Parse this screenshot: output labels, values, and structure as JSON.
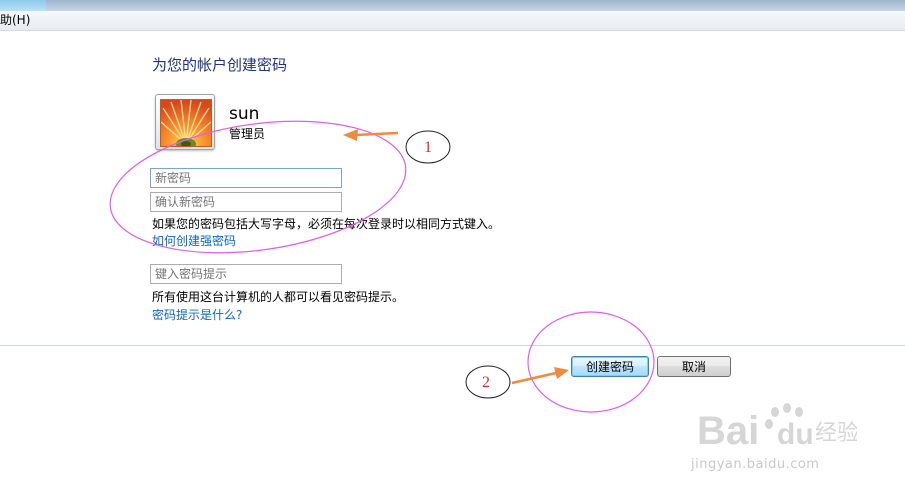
{
  "menu": {
    "help_label": "助(H)"
  },
  "page": {
    "title": "为您的帐户创建密码"
  },
  "user": {
    "name": "sun",
    "role": "管理员"
  },
  "form": {
    "new_password_placeholder": "新密码",
    "confirm_password_placeholder": "确认新密码",
    "case_note": "如果您的密码包括大写字母，必须在每次登录时以相同方式键入。",
    "strong_password_link": "如何创建强密码",
    "hint_placeholder": "键入密码提示",
    "hint_note": "所有使用这台计算机的人都可以看见密码提示。",
    "hint_link": "密码提示是什么?"
  },
  "buttons": {
    "create": "创建密码",
    "cancel": "取消"
  },
  "annotations": {
    "marker1": "1",
    "marker2": "2",
    "ellipse_color": "#e05ee8",
    "arrow_color": "#f08a3c",
    "marker_text_color": "#d9302a"
  },
  "watermark": {
    "brand_text": "Bai",
    "brand_suffix": "du",
    "brand_cn": "经验",
    "url": "jingyan.baidu.com"
  }
}
